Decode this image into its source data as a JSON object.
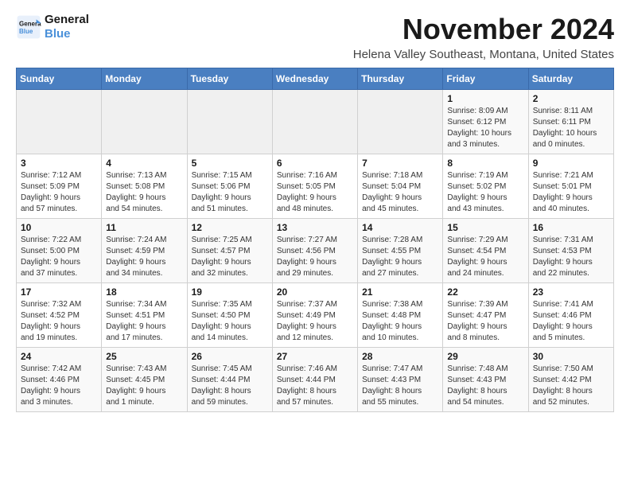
{
  "header": {
    "logo_line1": "General",
    "logo_line2": "Blue",
    "month_title": "November 2024",
    "location": "Helena Valley Southeast, Montana, United States"
  },
  "days_of_week": [
    "Sunday",
    "Monday",
    "Tuesday",
    "Wednesday",
    "Thursday",
    "Friday",
    "Saturday"
  ],
  "weeks": [
    [
      {
        "day": "",
        "info": ""
      },
      {
        "day": "",
        "info": ""
      },
      {
        "day": "",
        "info": ""
      },
      {
        "day": "",
        "info": ""
      },
      {
        "day": "",
        "info": ""
      },
      {
        "day": "1",
        "info": "Sunrise: 8:09 AM\nSunset: 6:12 PM\nDaylight: 10 hours\nand 3 minutes."
      },
      {
        "day": "2",
        "info": "Sunrise: 8:11 AM\nSunset: 6:11 PM\nDaylight: 10 hours\nand 0 minutes."
      }
    ],
    [
      {
        "day": "3",
        "info": "Sunrise: 7:12 AM\nSunset: 5:09 PM\nDaylight: 9 hours\nand 57 minutes."
      },
      {
        "day": "4",
        "info": "Sunrise: 7:13 AM\nSunset: 5:08 PM\nDaylight: 9 hours\nand 54 minutes."
      },
      {
        "day": "5",
        "info": "Sunrise: 7:15 AM\nSunset: 5:06 PM\nDaylight: 9 hours\nand 51 minutes."
      },
      {
        "day": "6",
        "info": "Sunrise: 7:16 AM\nSunset: 5:05 PM\nDaylight: 9 hours\nand 48 minutes."
      },
      {
        "day": "7",
        "info": "Sunrise: 7:18 AM\nSunset: 5:04 PM\nDaylight: 9 hours\nand 45 minutes."
      },
      {
        "day": "8",
        "info": "Sunrise: 7:19 AM\nSunset: 5:02 PM\nDaylight: 9 hours\nand 43 minutes."
      },
      {
        "day": "9",
        "info": "Sunrise: 7:21 AM\nSunset: 5:01 PM\nDaylight: 9 hours\nand 40 minutes."
      }
    ],
    [
      {
        "day": "10",
        "info": "Sunrise: 7:22 AM\nSunset: 5:00 PM\nDaylight: 9 hours\nand 37 minutes."
      },
      {
        "day": "11",
        "info": "Sunrise: 7:24 AM\nSunset: 4:59 PM\nDaylight: 9 hours\nand 34 minutes."
      },
      {
        "day": "12",
        "info": "Sunrise: 7:25 AM\nSunset: 4:57 PM\nDaylight: 9 hours\nand 32 minutes."
      },
      {
        "day": "13",
        "info": "Sunrise: 7:27 AM\nSunset: 4:56 PM\nDaylight: 9 hours\nand 29 minutes."
      },
      {
        "day": "14",
        "info": "Sunrise: 7:28 AM\nSunset: 4:55 PM\nDaylight: 9 hours\nand 27 minutes."
      },
      {
        "day": "15",
        "info": "Sunrise: 7:29 AM\nSunset: 4:54 PM\nDaylight: 9 hours\nand 24 minutes."
      },
      {
        "day": "16",
        "info": "Sunrise: 7:31 AM\nSunset: 4:53 PM\nDaylight: 9 hours\nand 22 minutes."
      }
    ],
    [
      {
        "day": "17",
        "info": "Sunrise: 7:32 AM\nSunset: 4:52 PM\nDaylight: 9 hours\nand 19 minutes."
      },
      {
        "day": "18",
        "info": "Sunrise: 7:34 AM\nSunset: 4:51 PM\nDaylight: 9 hours\nand 17 minutes."
      },
      {
        "day": "19",
        "info": "Sunrise: 7:35 AM\nSunset: 4:50 PM\nDaylight: 9 hours\nand 14 minutes."
      },
      {
        "day": "20",
        "info": "Sunrise: 7:37 AM\nSunset: 4:49 PM\nDaylight: 9 hours\nand 12 minutes."
      },
      {
        "day": "21",
        "info": "Sunrise: 7:38 AM\nSunset: 4:48 PM\nDaylight: 9 hours\nand 10 minutes."
      },
      {
        "day": "22",
        "info": "Sunrise: 7:39 AM\nSunset: 4:47 PM\nDaylight: 9 hours\nand 8 minutes."
      },
      {
        "day": "23",
        "info": "Sunrise: 7:41 AM\nSunset: 4:46 PM\nDaylight: 9 hours\nand 5 minutes."
      }
    ],
    [
      {
        "day": "24",
        "info": "Sunrise: 7:42 AM\nSunset: 4:46 PM\nDaylight: 9 hours\nand 3 minutes."
      },
      {
        "day": "25",
        "info": "Sunrise: 7:43 AM\nSunset: 4:45 PM\nDaylight: 9 hours\nand 1 minute."
      },
      {
        "day": "26",
        "info": "Sunrise: 7:45 AM\nSunset: 4:44 PM\nDaylight: 8 hours\nand 59 minutes."
      },
      {
        "day": "27",
        "info": "Sunrise: 7:46 AM\nSunset: 4:44 PM\nDaylight: 8 hours\nand 57 minutes."
      },
      {
        "day": "28",
        "info": "Sunrise: 7:47 AM\nSunset: 4:43 PM\nDaylight: 8 hours\nand 55 minutes."
      },
      {
        "day": "29",
        "info": "Sunrise: 7:48 AM\nSunset: 4:43 PM\nDaylight: 8 hours\nand 54 minutes."
      },
      {
        "day": "30",
        "info": "Sunrise: 7:50 AM\nSunset: 4:42 PM\nDaylight: 8 hours\nand 52 minutes."
      }
    ]
  ]
}
